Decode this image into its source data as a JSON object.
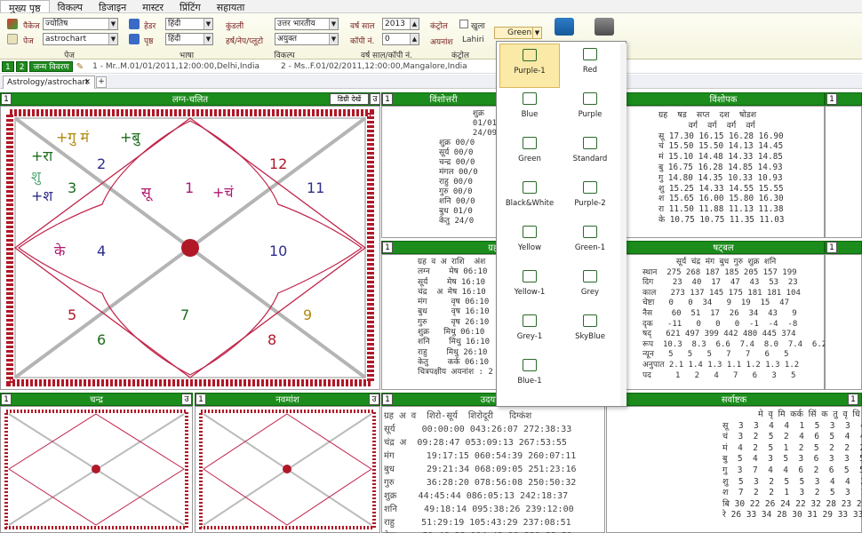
{
  "menu": [
    "मुख्य पृष्ठ",
    "विकल्प",
    "डिजाइन",
    "मास्टर",
    "प्रिंटिंग",
    "सहायता"
  ],
  "ribbon": {
    "package_label": "पैकेज",
    "package_value": "ज्योतिष",
    "page_label": "पेज",
    "page_value": "astrochart",
    "header_label": "हेडर",
    "header_value": "हिंदी",
    "page2_label": "पृष्ठ",
    "page2_value": "हिंदी",
    "kundli_label": "कुंडली",
    "kundli_value": "उत्तर भारतीय",
    "shadow_label": "हर्ष/नेप/प्लूटो",
    "shadow_value": "अयुक्त",
    "year_label": "वर्ष साल",
    "year_value": "2013",
    "copy_label": "कॉपी नं.",
    "copy_value": "0",
    "control_label": "कंट्रोल",
    "open_label": "खुला",
    "ayanansh_label": "अयनांश",
    "ayanansh_value": "Lahiri",
    "color_value": "Green",
    "group_page": "पेज",
    "group_language": "भाषा",
    "group_option": "विकल्प",
    "group_year": "वर्ष साल/कॉपी नं.",
    "group_control": "कंट्रोल"
  },
  "subbar": {
    "b1": "1",
    "b2": "2",
    "b3": "जन्म विवरण",
    "p1": "1 - Mr..M.01/01/2011,12:00:00,Delhi,India",
    "p2": "2 - Ms..F.01/02/2011,12:00:00,Mangalore,India"
  },
  "tab": {
    "label": "Astrology/astrochart"
  },
  "panels": {
    "lagna": {
      "num": "1",
      "title": "लग्न-चलित",
      "extra": "डिग्री देखें",
      "u": "उ"
    },
    "vimshottari": {
      "num": "1",
      "title": "विंशोत्तरी"
    },
    "vishopak": {
      "title": "विंशोपक",
      "num": "1"
    },
    "grahaspasht": {
      "num": "1",
      "title": "ग्रह स्पष्ट"
    },
    "shadbal": {
      "title": "षट्बल",
      "num": "1"
    },
    "chandra": {
      "num": "1",
      "title": "चन्द्र",
      "u": "उ"
    },
    "navamsh": {
      "num": "1",
      "title": "नवमांश",
      "u": "उ"
    },
    "udayast": {
      "num": "1",
      "title": "उदयास्त"
    },
    "sarvashtak": {
      "title": "सर्वाष्टक",
      "num": "1"
    }
  },
  "lagna_chart": {
    "houses": [
      "1",
      "2",
      "3",
      "4",
      "5",
      "6",
      "7",
      "8",
      "9",
      "10",
      "11",
      "12"
    ],
    "planets": {
      "h1a": "सू",
      "h1b": "+चं",
      "h12": "+गु मं",
      "h12b": "+बु",
      "h2a": "+रा",
      "h2b": "शु",
      "h2c": "+श",
      "h4": "के"
    }
  },
  "vimsh_text": "       शुक्र\n       01/01\n       24/09\nशुक्र 00/0\nसूर्य 00/0\nचन्द्र 00/0\nमंगल 00/0\nराहु 00/0\nगुरु 00/0\nशनि 00/0\nबुध 01/0\nकेतु 24/0",
  "vishopak_text": "ग्रह  षड  सप्त  दश  षोडश\n      वर्ग  वर्ग  वर्ग  वर्ग\nसू 17.30 16.15 16.28 16.90\nचं 15.50 15.50 14.13 14.45\nमं 15.10 14.48 14.33 14.85\nबु 16.75 16.28 14.85 14.93\nगु 14.80 14.35 10.33 10.93\nशु 15.25 14.33 14.55 15.55\nश 15.65 16.00 15.80 16.30\nरा 11.50 11.88 11.13 11.38\nके 10.75 10.75 11.35 11.03",
  "graha_text": "ग्रह व अ राशि  अंश\nलग्न    मेष 06:10\nसूर्य    मेष 16:10\nचंद्र  अ मेष 16:10\nमंग     वृष 06:10\nबुध     वृष 16:10\nगुरु     वृष 26:10\nशुक्र   मिथु 06:10\nशनि    मिथु 16:10\nराहु    मिथु 26:10\nकेतु    कर्क 06:10\nचित्रपक्षीय अयनांश : 2",
  "shadbal_text": "       सूर्य चंद्र मंग बुध गुरु शुक्र शनि\nस्थान  275 268 187 185 205 157 199\nदिग    23  40  17  47  43  53  23\nकाल   273 137 145 175 181 181 104\nचेष्टा   0   0  34   9  19  15  47\nनैस    60  51  17  26  34  43   9\nदृक   -11   0   0   0  -1  -4  -8\nषद्   621 497 399 442 480 445 374\nरूप  10.3  8.3  6.6  7.4  8.0  7.4  6.2\nन्यून   5   5   5   7   7   6   5\nअनुपात 2.1 1.4 1.3 1.1 1.2 1.3 1.2\nपद     1   2   4   7   6   3   5",
  "udayast_text": "ग्रह अ व  शिरो-सूर्य  शिरोदूरी   दिग्कंश\nसूर्य     00:00:00 043:26:07 272:38:33\nचंद्र अ  09:28:47 053:09:13 267:53:55\nमंग      19:17:15 060:54:39 260:07:11\nबुध      29:21:34 068:09:05 251:23:16\nगुरु      36:28:20 078:56:08 250:50:32\nशुक्र    44:45:44 086:05:13 242:18:37\nशनि     49:18:14 095:38:26 239:12:00\nराहु     51:29:19 105:43:29 237:08:51\nकेतु     51:46:33 114:43:19 229:22:21",
  "sarv_text": "       मे वृ मि कर्क सिं क तु वृ धि म\nसू  3  3  4  4  1  5  3  3  4  7\nचं  3  2  5  2  4  6  5  4  4  3\nमं  4  2  5  1  2  5  2  2  2  4\nबु  5  4  3  5  3  6  3  3  5  4\nगु  3  7  4  4  6  2  6  5  5  3\nशु  5  3  2  5  5  3  4  4  2  3\nश  7  2  2  1  3  2  5  3  1  3\nबि 30 22 26 24 22 32 28 23 23 31\nरे 26 33 34 28 30 31 29 33 33 25",
  "dropdown": {
    "items": [
      "Purple-1",
      "Red",
      "Blue",
      "Purple",
      "Green",
      "Standard",
      "Black&White",
      "Purple-2",
      "Yellow",
      "Green-1",
      "Yellow-1",
      "Grey",
      "Grey-1",
      "SkyBlue",
      "Blue-1"
    ]
  },
  "colors": {
    "accent": "#1c8c1c",
    "chart_border": "#b01828"
  }
}
